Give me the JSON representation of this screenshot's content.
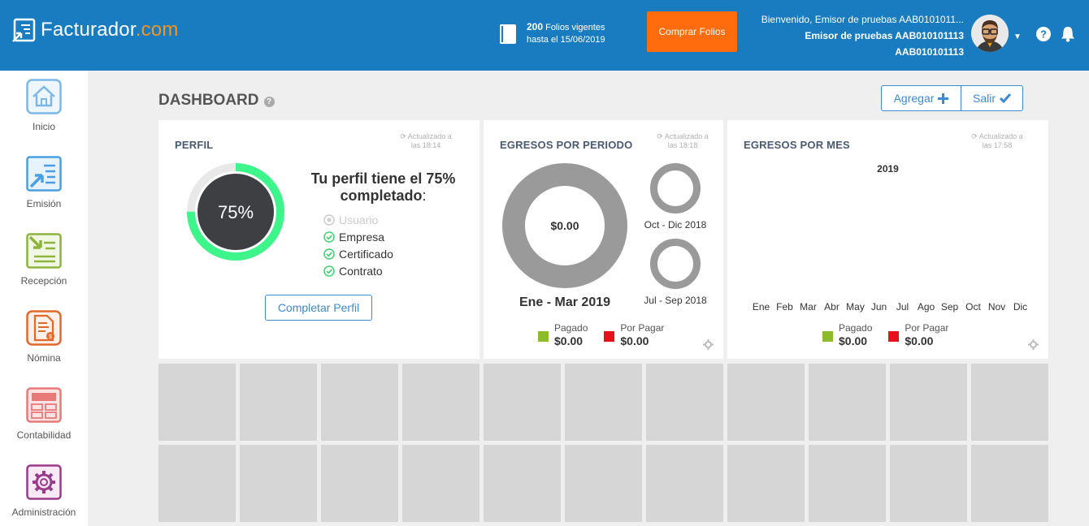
{
  "header": {
    "logo_main": "Facturador",
    "logo_dot": ".com",
    "folios_count": "200",
    "folios_label": "Folios vigentes",
    "folios_until": "hasta el 15/06/2019",
    "buy_button": "Comprar Folios",
    "welcome_line": "Bienvenido, Emisor de pruebas AAB0101011...",
    "user_name": "Emisor de pruebas AAB010101113",
    "user_rfc": "AAB010101113"
  },
  "sidebar": {
    "items": [
      {
        "label": "Inicio",
        "icon": "home-icon",
        "color": "#7bb8e6"
      },
      {
        "label": "Emisión",
        "icon": "invoice-send-icon",
        "color": "#4a9fe0"
      },
      {
        "label": "Recepción",
        "icon": "invoice-receive-icon",
        "color": "#8db43c"
      },
      {
        "label": "Nómina",
        "icon": "payroll-icon",
        "color": "#e06a2c"
      },
      {
        "label": "Contabilidad",
        "icon": "calculator-icon",
        "color": "#e87a7a"
      },
      {
        "label": "Administración",
        "icon": "gear-icon",
        "color": "#9a3a8a"
      }
    ]
  },
  "main": {
    "title": "DASHBOARD",
    "add_button": "Agregar",
    "exit_button": "Salir"
  },
  "perfil": {
    "title": "PERFIL",
    "updated_line1": "Actualizado a",
    "updated_line2": "las 18:14",
    "percent_label": "75%",
    "progress": 0.75,
    "headline_1": "Tu perfil tiene el 75%",
    "headline_2": "completado",
    "headline_colon": ":",
    "checklist": [
      {
        "label": "Usuario",
        "done": false
      },
      {
        "label": "Empresa",
        "done": true
      },
      {
        "label": "Certificado",
        "done": true
      },
      {
        "label": "Contrato",
        "done": true
      }
    ],
    "button": "Completar Perfil"
  },
  "egresos_periodo": {
    "title": "EGRESOS POR PERIODO",
    "updated_line1": "Actualizado a",
    "updated_line2": "las 18:18",
    "main_value": "$0.00",
    "main_period": "Ene - Mar 2019",
    "small_periods": [
      "Oct - Dic 2018",
      "Jul - Sep 2018"
    ],
    "paid_label": "Pagado",
    "paid_value": "$0.00",
    "pending_label": "Por Pagar",
    "pending_value": "$0.00"
  },
  "egresos_mes": {
    "title": "EGRESOS POR MES",
    "updated_line1": "Actualizado a",
    "updated_line2": "las 17:58",
    "year": "2019",
    "months": [
      "Ene",
      "Feb",
      "Mar",
      "Abr",
      "May",
      "Jun",
      "Jul",
      "Ago",
      "Sep",
      "Oct",
      "Nov",
      "Dic"
    ],
    "paid_label": "Pagado",
    "paid_value": "$0.00",
    "pending_label": "Por Pagar",
    "pending_value": "$0.00"
  },
  "colors": {
    "header_blue": "#1a7cc0",
    "buy_orange": "#ff6c0e",
    "progress_green": "#3df58a",
    "donut_gray": "#9a9a9a",
    "paid_green": "#8dbb2c",
    "pending_red": "#e8111a"
  }
}
